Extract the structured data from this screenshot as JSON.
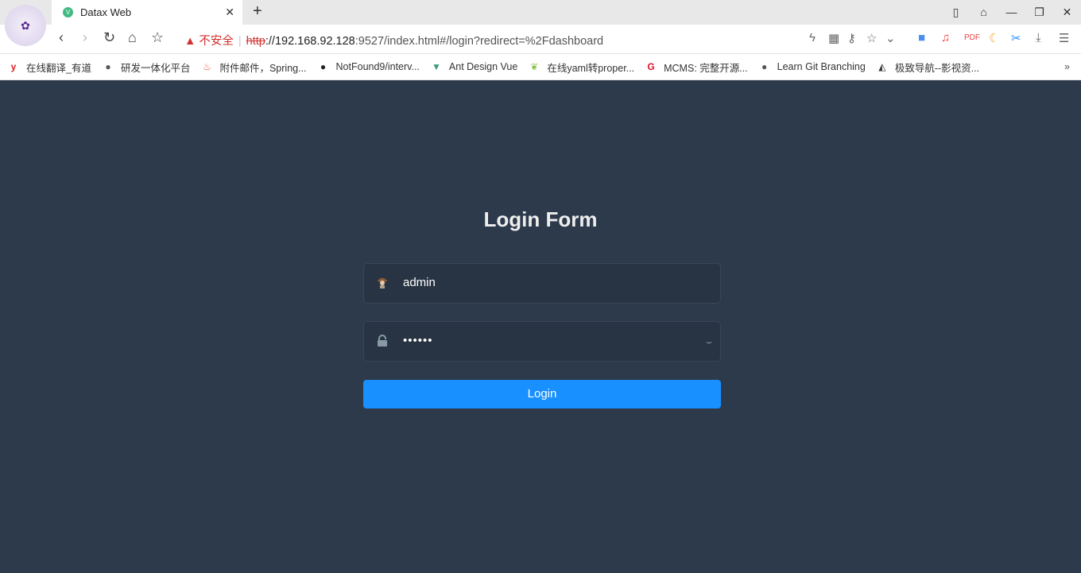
{
  "browser": {
    "tab_title": "Datax Web",
    "url": {
      "warning": "不安全",
      "scheme": "http",
      "host": "://192.168.92.128",
      "rest": ":9527/index.html#/login?redirect=%2Fdashboard"
    },
    "bookmarks": [
      {
        "label": "在线翻译_有道",
        "icon": "youdao-icon",
        "color": "#e02020"
      },
      {
        "label": "研发一体化平台",
        "icon": "globe-icon",
        "color": "#555"
      },
      {
        "label": "附件邮件，Spring...",
        "icon": "flame-icon",
        "color": "#e8553c"
      },
      {
        "label": "NotFound9/interv...",
        "icon": "github-icon",
        "color": "#222"
      },
      {
        "label": "Ant Design Vue",
        "icon": "vue-icon",
        "color": "#3a9a7a"
      },
      {
        "label": "在线yaml转proper...",
        "icon": "leaf-icon",
        "color": "#8bc34a"
      },
      {
        "label": "MCMS: 完整开源...",
        "icon": "mcms-icon",
        "color": "#e0102a"
      },
      {
        "label": "Learn Git Branching",
        "icon": "globe-icon",
        "color": "#555"
      },
      {
        "label": "极致导航--影视资...",
        "icon": "nav-icon",
        "color": "#333"
      }
    ]
  },
  "login": {
    "title": "Login Form",
    "username": "admin",
    "password": "••••••",
    "button": "Login"
  },
  "colors": {
    "background": "#2d3a4b",
    "input_bg": "#283443",
    "button": "#1890ff"
  }
}
